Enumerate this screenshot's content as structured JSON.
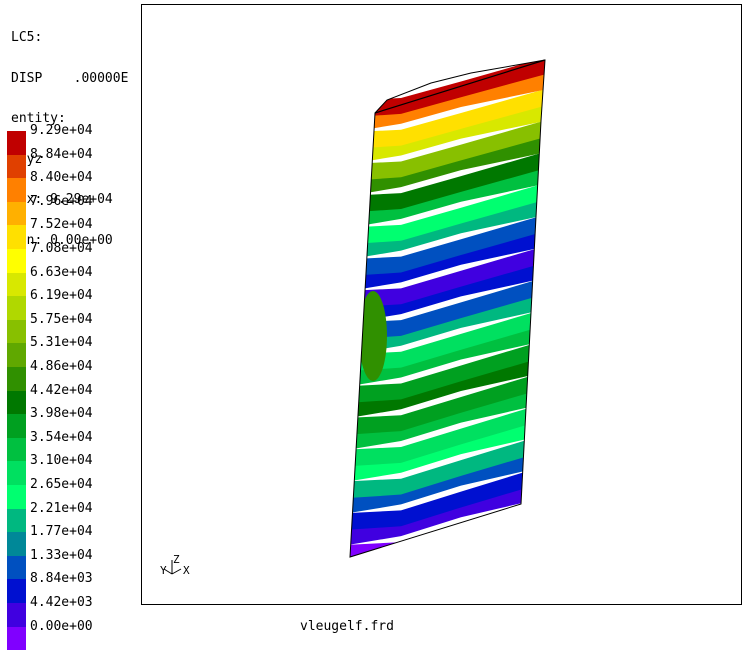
{
  "info": {
    "loadcase": "LC5:",
    "dataset": "DISP",
    "value": ".00000E",
    "entity_label": "entity:",
    "entity": "dxyz",
    "max": "max: 9.29e+04",
    "min": "min: 0.00e+00"
  },
  "legend": [
    {
      "label": "9.29e+04",
      "color": "#c00000"
    },
    {
      "label": "8.84e+04",
      "color": "#e04000"
    },
    {
      "label": "8.40e+04",
      "color": "#ff8000"
    },
    {
      "label": "7.96e+04",
      "color": "#ffb000"
    },
    {
      "label": "7.52e+04",
      "color": "#ffe000"
    },
    {
      "label": "7.08e+04",
      "color": "#ffff00"
    },
    {
      "label": "6.63e+04",
      "color": "#d8e800"
    },
    {
      "label": "6.19e+04",
      "color": "#b0d800"
    },
    {
      "label": "5.75e+04",
      "color": "#88c000"
    },
    {
      "label": "5.31e+04",
      "color": "#60a800"
    },
    {
      "label": "4.86e+04",
      "color": "#309000"
    },
    {
      "label": "4.42e+04",
      "color": "#007800"
    },
    {
      "label": "3.98e+04",
      "color": "#00a020"
    },
    {
      "label": "3.54e+04",
      "color": "#00c040"
    },
    {
      "label": "3.10e+04",
      "color": "#00e060"
    },
    {
      "label": "2.65e+04",
      "color": "#00ff70"
    },
    {
      "label": "2.21e+04",
      "color": "#00b880"
    },
    {
      "label": "1.77e+04",
      "color": "#008898"
    },
    {
      "label": "1.33e+04",
      "color": "#0050c0"
    },
    {
      "label": "8.84e+03",
      "color": "#0010d0"
    },
    {
      "label": "4.42e+03",
      "color": "#4000e0"
    },
    {
      "label": "0.00e+00",
      "color": "#8000ff"
    }
  ],
  "axes": {
    "z": "Z",
    "y": "Y",
    "x": "X"
  },
  "filename": "vleugelf.frd",
  "bands": [
    {
      "color": "#8000ff"
    },
    {
      "color": "#4000e0"
    },
    {
      "color": "#0010d0"
    },
    {
      "color": "#0050c0"
    },
    {
      "color": "#00b880"
    },
    {
      "color": "#00ff70"
    },
    {
      "color": "#00e060"
    },
    {
      "color": "#00c040"
    },
    {
      "color": "#00a020"
    },
    {
      "color": "#007800"
    },
    {
      "color": "#00a020"
    },
    {
      "color": "#00c040"
    },
    {
      "color": "#00e060"
    },
    {
      "color": "#00b880"
    },
    {
      "color": "#0050c0"
    },
    {
      "color": "#0010d0"
    },
    {
      "color": "#4000e0"
    },
    {
      "color": "#0010d0"
    },
    {
      "color": "#0050c0"
    },
    {
      "color": "#00b880"
    },
    {
      "color": "#00ff70"
    },
    {
      "color": "#00c040"
    },
    {
      "color": "#007800"
    },
    {
      "color": "#309000"
    },
    {
      "color": "#88c000"
    },
    {
      "color": "#d8e800"
    },
    {
      "color": "#ffe000"
    },
    {
      "color": "#ff8000"
    },
    {
      "color": "#c00000"
    }
  ]
}
